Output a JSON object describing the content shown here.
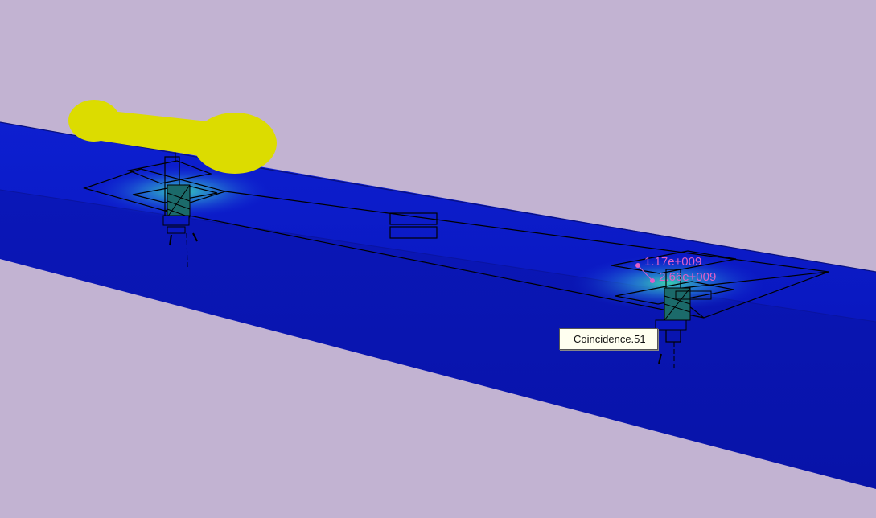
{
  "viewport": {
    "background_color": "#c2b3d2",
    "beam_color": "#0a1ac8",
    "hotspot_color": "#2ec6c0",
    "probe_color": "#dcdc00"
  },
  "annotations": {
    "value_top": "1.17e+009",
    "value_bottom": "2.66e+009",
    "label_color": "#e060c8"
  },
  "tooltip": {
    "text": "Coincidence.51"
  },
  "icons": {
    "probe": "probe-handle-icon",
    "constraint": "equal-constraint-icon",
    "fastener": "bolt-icon"
  }
}
